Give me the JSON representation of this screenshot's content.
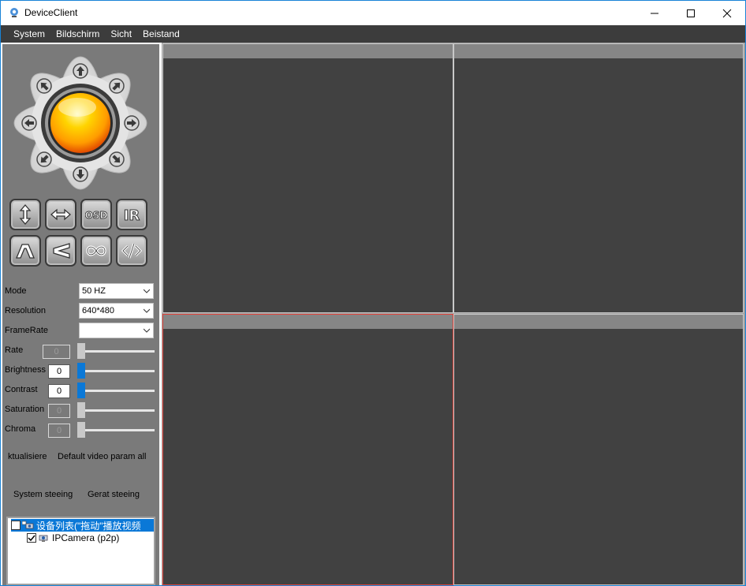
{
  "window": {
    "title": "DeviceClient"
  },
  "menu": {
    "items": [
      "System",
      "Bildschirm",
      "Sicht",
      "Beistand"
    ]
  },
  "ptz": {
    "directions": [
      "up",
      "up-right",
      "right",
      "down-right",
      "down",
      "down-left",
      "left",
      "up-left"
    ]
  },
  "functions": {
    "buttons": [
      {
        "name": "vertical-flip-button",
        "icon": "vertical-arrows-icon"
      },
      {
        "name": "horizontal-flip-button",
        "icon": "horizontal-arrows-icon"
      },
      {
        "name": "osd-button",
        "label": "OSD"
      },
      {
        "name": "ir-button",
        "label": "IR"
      },
      {
        "name": "patrol-vertical-button",
        "icon": "up-chevron-icon"
      },
      {
        "name": "patrol-horizontal-button",
        "icon": "left-chevron-icon"
      },
      {
        "name": "cruise-button",
        "icon": "infinity-icon"
      },
      {
        "name": "code-button",
        "icon": "code-icon"
      }
    ]
  },
  "settings": {
    "mode": {
      "label": "Mode",
      "value": "50 HZ"
    },
    "resolution": {
      "label": "Resolution",
      "value": "640*480"
    },
    "framerate": {
      "label": "FrameRate",
      "value": ""
    },
    "rate": {
      "label": "Rate",
      "value": "0",
      "level": 0
    },
    "brightness": {
      "label": "Brightness",
      "value": "0",
      "level": 0
    },
    "contrast": {
      "label": "Contrast",
      "value": "0",
      "level": 0
    },
    "saturation": {
      "label": "Saturation",
      "value": "0",
      "level": 0
    },
    "chroma": {
      "label": "Chroma",
      "value": "0",
      "level": 0
    }
  },
  "actions": {
    "refresh": "ktualisiere",
    "default": "Default video param all",
    "system_steering": "System steeing",
    "gerat_steering": "Gerat steeing"
  },
  "tree": {
    "root": "设备列表(\"拖动\"播放视频",
    "child": "IPCamera (p2p)"
  },
  "colors": {
    "accent": "#0a78d7",
    "selected_pane": "#e0433a",
    "panel": "#7a7a7a",
    "video_bg": "#414141"
  }
}
